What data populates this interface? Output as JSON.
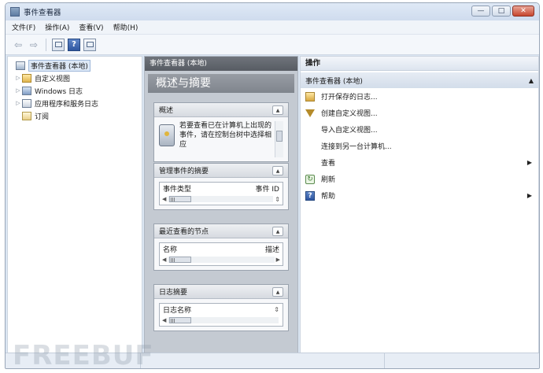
{
  "window": {
    "title": "事件查看器",
    "controls": {
      "minimize": "—",
      "maximize": "□",
      "close": "✕"
    }
  },
  "menubar": {
    "items": [
      "文件(F)",
      "操作(A)",
      "查看(V)",
      "帮助(H)"
    ]
  },
  "toolbar": {
    "back_icon": "back-arrow-icon",
    "forward_icon": "forward-arrow-icon",
    "help_label": "?"
  },
  "tree": {
    "root": "事件查看器 (本地)",
    "items": [
      {
        "label": "自定义视图",
        "icon": "folder-icon"
      },
      {
        "label": "Windows 日志",
        "icon": "log-icon"
      },
      {
        "label": "应用程序和服务日志",
        "icon": "apps-log-icon"
      },
      {
        "label": "订阅",
        "icon": "subscription-icon"
      }
    ]
  },
  "center": {
    "header": "事件查看器 (本地)",
    "overview_title": "概述与摘要",
    "sections": {
      "overview": {
        "title": "概述",
        "text": "若要查看已在计算机上出现的事件，请在控制台树中选择相应"
      },
      "admin_events": {
        "title": "管理事件的摘要",
        "col1": "事件类型",
        "col2": "事件 ID",
        "scroll_mark": "III"
      },
      "recent_nodes": {
        "title": "最近查看的节点",
        "col1": "名称",
        "col2": "描述",
        "scroll_mark": "III"
      },
      "log_summary": {
        "title": "日志摘要",
        "col1": "日志名称",
        "col2": "",
        "scroll_mark": "III"
      }
    }
  },
  "actions": {
    "header": "操作",
    "group": "事件查看器 (本地)",
    "items": [
      {
        "label": "打开保存的日志...",
        "icon": "open-log-icon",
        "submenu": false
      },
      {
        "label": "创建自定义视图...",
        "icon": "filter-icon",
        "submenu": false
      },
      {
        "label": "导入自定义视图...",
        "icon": "",
        "submenu": false
      },
      {
        "label": "连接到另一台计算机...",
        "icon": "",
        "submenu": false
      },
      {
        "label": "查看",
        "icon": "",
        "submenu": true
      },
      {
        "label": "刷新",
        "icon": "refresh-icon",
        "submenu": false
      },
      {
        "label": "帮助",
        "icon": "help-icon",
        "submenu": true
      }
    ]
  },
  "watermark": "FREEBUF",
  "colors": {
    "pane_header": "#575c63",
    "center_background": "#c4cad2",
    "window_frame": "#dbe6f3",
    "close_button": "#c7472f"
  }
}
